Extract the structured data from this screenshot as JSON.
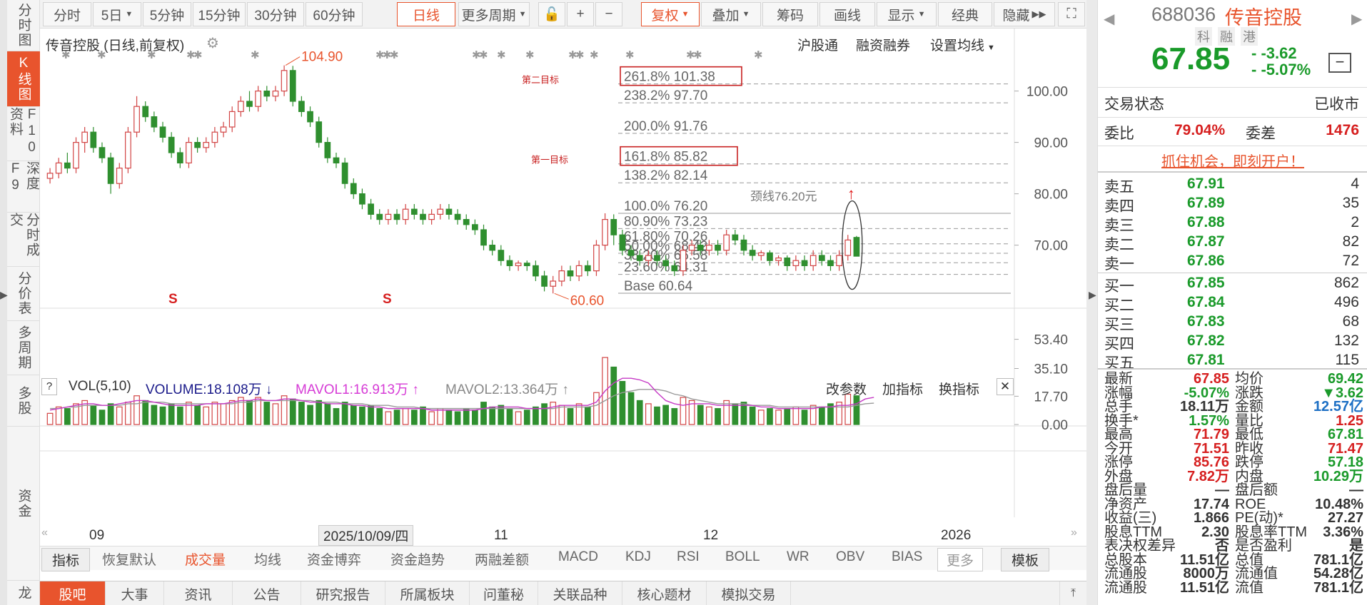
{
  "left_nav": [
    "分时图",
    "K线图",
    "F10资料",
    "深度F9",
    "分时成交",
    "分价表",
    "多周期",
    "多股",
    "资金",
    "龙"
  ],
  "toolbar": {
    "periods": [
      "分时",
      "5日",
      "5分钟",
      "15分钟",
      "30分钟",
      "60分钟",
      "日线",
      "更多周期"
    ],
    "tools": [
      "复权",
      "叠加",
      "筹码",
      "画线",
      "显示",
      "经典",
      "隐藏"
    ]
  },
  "chart_header": {
    "title": "传音控股  (日线,前复权)",
    "links": [
      "沪股通",
      "融资融券",
      "设置均线"
    ]
  },
  "annotations": {
    "high_label": "104.90",
    "low_label": "60.60",
    "target2_label": "第二目标",
    "target1_label": "第一目标",
    "neckline_label": "颈线76.20元",
    "fib_levels": [
      {
        "label": "261.8% 101.38",
        "value": 101.38,
        "boxed": true
      },
      {
        "label": "238.2% 97.70",
        "value": 97.7
      },
      {
        "label": "200.0% 91.76",
        "value": 91.76
      },
      {
        "label": "161.8% 85.82",
        "value": 85.82,
        "boxed": true
      },
      {
        "label": "138.2% 82.14",
        "value": 82.14
      },
      {
        "label": "100.0% 76.20",
        "value": 76.2
      },
      {
        "label": "80.90% 73.23",
        "value": 73.23
      },
      {
        "label": "61.80% 70.26",
        "value": 70.26
      },
      {
        "label": "50.00% 68.42",
        "value": 68.42
      },
      {
        "label": "38.20% 66.58",
        "value": 66.58
      },
      {
        "label": "23.60% 64.31",
        "value": 64.31
      },
      {
        "label": "Base 60.64",
        "value": 60.64
      }
    ]
  },
  "volume_header": {
    "q": "?",
    "vol": "VOL(5,10)",
    "volume": "VOLUME:18.108万",
    "mavol1": "MAVOL1:16.913万",
    "mavol2": "MAVOL2:13.364万",
    "links": [
      "改参数",
      "加指标",
      "换指标"
    ]
  },
  "x_axis": {
    "labels": [
      "09",
      "11",
      "12",
      "2026"
    ],
    "cursor_date": "2025/10/09/四"
  },
  "indicator_tabs": [
    "指标",
    "恢复默认",
    "成交量",
    "均线",
    "资金博弈",
    "资金趋势",
    "两融差额",
    "MACD",
    "KDJ",
    "RSI",
    "BOLL",
    "WR",
    "OBV",
    "BIAS",
    "更多",
    "模板"
  ],
  "bottom_tabs": [
    "股吧",
    "大事",
    "资讯",
    "公告",
    "研究报告",
    "所属板块",
    "问董秘",
    "关联品种",
    "核心题材",
    "模拟交易"
  ],
  "quote": {
    "code": "688036",
    "name": "传音控股",
    "tags": [
      "科",
      "融",
      "港"
    ],
    "price": "67.85",
    "change": "-3.62",
    "change_pct": "-5.07%",
    "status_label": "交易状态",
    "status_value": "已收市",
    "ratio_label": "委比",
    "ratio_value": "79.04%",
    "diff_label": "委差",
    "diff_value": "1476",
    "promo": "抓住机会，即刻开户！",
    "asks": [
      {
        "label": "卖五",
        "price": "67.91",
        "vol": "4"
      },
      {
        "label": "卖四",
        "price": "67.89",
        "vol": "35"
      },
      {
        "label": "卖三",
        "price": "67.88",
        "vol": "2"
      },
      {
        "label": "卖二",
        "price": "67.87",
        "vol": "82"
      },
      {
        "label": "卖一",
        "price": "67.86",
        "vol": "72"
      }
    ],
    "bids": [
      {
        "label": "买一",
        "price": "67.85",
        "vol": "862"
      },
      {
        "label": "买二",
        "price": "67.84",
        "vol": "496"
      },
      {
        "label": "买三",
        "price": "67.83",
        "vol": "68"
      },
      {
        "label": "买四",
        "price": "67.82",
        "vol": "132"
      },
      {
        "label": "买五",
        "price": "67.81",
        "vol": "115"
      }
    ],
    "stats": [
      [
        "最新",
        "67.85",
        "均价",
        "69.42"
      ],
      [
        "涨幅",
        "-5.07%",
        "涨跌",
        "▼3.62"
      ],
      [
        "总手",
        "18.11万",
        "金额",
        "12.57亿"
      ],
      [
        "换手*",
        "1.57%",
        "量比",
        "1.25"
      ],
      [
        "最高",
        "71.79",
        "最低",
        "67.81"
      ],
      [
        "今开",
        "71.51",
        "昨收",
        "71.47"
      ],
      [
        "涨停",
        "85.76",
        "跌停",
        "57.18"
      ],
      [
        "外盘",
        "7.82万",
        "内盘",
        "10.29万"
      ],
      [
        "盘后量",
        "—",
        "盘后额",
        "—"
      ],
      [
        "净资产",
        "17.74",
        "ROE",
        "10.48%"
      ],
      [
        "收益(三)",
        "1.866",
        "PE(动)*",
        "27.27"
      ],
      [
        "股息TTM",
        "2.30",
        "股息率TTM",
        "3.36%"
      ],
      [
        "表决权差异",
        "否",
        "是否盈利",
        "是"
      ],
      [
        "总股本",
        "11.51亿",
        "总值",
        "781.1亿"
      ],
      [
        "流通股",
        "8000万",
        "流通值",
        "54.28亿"
      ],
      [
        "流通股",
        "11.51亿",
        "流值",
        "781.1亿"
      ]
    ]
  },
  "chart_data": {
    "type": "candlestick",
    "y_ticks": [
      100.0,
      90.0,
      80.0,
      70.0
    ],
    "ylim": [
      58,
      108
    ],
    "vol_ticks": [
      "53.40",
      "35.10",
      "17.70",
      "0.00"
    ],
    "vol_max": 55,
    "candles": [
      [
        83,
        84,
        82,
        85,
        7
      ],
      [
        84,
        86,
        83,
        87,
        11
      ],
      [
        86,
        85,
        84,
        88,
        10
      ],
      [
        85,
        90,
        84,
        91,
        13
      ],
      [
        90,
        92,
        88,
        93,
        15
      ],
      [
        92,
        89,
        88,
        93,
        12
      ],
      [
        89,
        87,
        86,
        90,
        9
      ],
      [
        87,
        82,
        80,
        88,
        13
      ],
      [
        82,
        85,
        81,
        86,
        11
      ],
      [
        85,
        92,
        84,
        93,
        14
      ],
      [
        92,
        97,
        91,
        99,
        18
      ],
      [
        97,
        95,
        94,
        98,
        15
      ],
      [
        95,
        93,
        92,
        96,
        12
      ],
      [
        93,
        91,
        90,
        94,
        11
      ],
      [
        91,
        88,
        87,
        92,
        13
      ],
      [
        88,
        86,
        85,
        89,
        11
      ],
      [
        86,
        90,
        85,
        91,
        14
      ],
      [
        90,
        89,
        88,
        91,
        12
      ],
      [
        89,
        90,
        88,
        91,
        11
      ],
      [
        90,
        92,
        89,
        93,
        14
      ],
      [
        92,
        93,
        91,
        94,
        13
      ],
      [
        93,
        96,
        92,
        97,
        15
      ],
      [
        96,
        98,
        95,
        99,
        17
      ],
      [
        98,
        97,
        96,
        100,
        15
      ],
      [
        97,
        100,
        96,
        101,
        17
      ],
      [
        100,
        99,
        98,
        101,
        14
      ],
      [
        99,
        100,
        98,
        101,
        13
      ],
      [
        100,
        104,
        99,
        105,
        18
      ],
      [
        104,
        98,
        97,
        104.9,
        16
      ],
      [
        98,
        96,
        95,
        99,
        14
      ],
      [
        96,
        94,
        93,
        97,
        12
      ],
      [
        94,
        90,
        89,
        95,
        15
      ],
      [
        90,
        87,
        86,
        91,
        13
      ],
      [
        87,
        86,
        85,
        88,
        10
      ],
      [
        86,
        82,
        81,
        87,
        14
      ],
      [
        82,
        80,
        79,
        83,
        12
      ],
      [
        80,
        78,
        77,
        81,
        11
      ],
      [
        78,
        76,
        75,
        79,
        12
      ],
      [
        76,
        75,
        74,
        77,
        10
      ],
      [
        75,
        76,
        74,
        77,
        8
      ],
      [
        76,
        75,
        74,
        77,
        9
      ],
      [
        75,
        77,
        74,
        78,
        10
      ],
      [
        77,
        76,
        75,
        78,
        9
      ],
      [
        76,
        75,
        74,
        77,
        11
      ],
      [
        75,
        76,
        74,
        77,
        8
      ],
      [
        76,
        77,
        75,
        78,
        10
      ],
      [
        77,
        76,
        75,
        78,
        9
      ],
      [
        76,
        75,
        74,
        77,
        8
      ],
      [
        75,
        74,
        73,
        76,
        10
      ],
      [
        74,
        73,
        72,
        75,
        9
      ],
      [
        73,
        70,
        69,
        74,
        14
      ],
      [
        70,
        69,
        68,
        71,
        11
      ],
      [
        69,
        67,
        66,
        70,
        12
      ],
      [
        67,
        66,
        65,
        68,
        10
      ],
      [
        66,
        66.5,
        65,
        67,
        8
      ],
      [
        66.5,
        66,
        65,
        67,
        9
      ],
      [
        66,
        64,
        63,
        67,
        11
      ],
      [
        64,
        62,
        61,
        65,
        13
      ],
      [
        62,
        63,
        60.6,
        64,
        14
      ],
      [
        63,
        65,
        62,
        66,
        12
      ],
      [
        65,
        64,
        63,
        66,
        10
      ],
      [
        64,
        66,
        63,
        67,
        13
      ],
      [
        66,
        65,
        64,
        67,
        11
      ],
      [
        65,
        70,
        64,
        71,
        20
      ],
      [
        70,
        75,
        69,
        76.2,
        42
      ],
      [
        75,
        72,
        70,
        76,
        36
      ],
      [
        72,
        69,
        68,
        73,
        27
      ],
      [
        69,
        68,
        67,
        70,
        20
      ],
      [
        68,
        67,
        66,
        69,
        15
      ],
      [
        67,
        68,
        66,
        69,
        13
      ],
      [
        68,
        67,
        66,
        69,
        11
      ],
      [
        67,
        66,
        65,
        68,
        12
      ],
      [
        66,
        65,
        64,
        67,
        10
      ],
      [
        65,
        69,
        64,
        70,
        17
      ],
      [
        69,
        70,
        68,
        71,
        15
      ],
      [
        70,
        69,
        68,
        71,
        12
      ],
      [
        69,
        70,
        68,
        71,
        11
      ],
      [
        70,
        69,
        68,
        71,
        10
      ],
      [
        69,
        72,
        68,
        73,
        15
      ],
      [
        72,
        71,
        70,
        73,
        13
      ],
      [
        71,
        69,
        68,
        72,
        14
      ],
      [
        69,
        68,
        67,
        70,
        11
      ],
      [
        68,
        68.5,
        67,
        69,
        9
      ],
      [
        68.5,
        67,
        66,
        69,
        10
      ],
      [
        67,
        67.5,
        66,
        68,
        9
      ],
      [
        67.5,
        66,
        65,
        68,
        10
      ],
      [
        66,
        67,
        65,
        68,
        11
      ],
      [
        67,
        66,
        65,
        68,
        9
      ],
      [
        66,
        68,
        65,
        69,
        12
      ],
      [
        68,
        67,
        66,
        69,
        11
      ],
      [
        67,
        66,
        65,
        68,
        13
      ],
      [
        66,
        68,
        65,
        69,
        14
      ],
      [
        68,
        71,
        67,
        72,
        19
      ],
      [
        71.5,
        67.85,
        67.81,
        71.79,
        18
      ]
    ],
    "mavol1": [
      9,
      10,
      11,
      12,
      13,
      13,
      12,
      12,
      13,
      14,
      15,
      15,
      14,
      13,
      12,
      12,
      12,
      12,
      13,
      13,
      13,
      14,
      15,
      15,
      16,
      15,
      15,
      16,
      16,
      15,
      14,
      14,
      13,
      13,
      13,
      12,
      12,
      11,
      11,
      10,
      10,
      10,
      10,
      10,
      9,
      9,
      9,
      9,
      9,
      9,
      10,
      11,
      11,
      11,
      11,
      10,
      10,
      10,
      11,
      12,
      12,
      12,
      12,
      14,
      21,
      26,
      29,
      29,
      28,
      26,
      20,
      15,
      13,
      12,
      13,
      13,
      13,
      12,
      12,
      12,
      12,
      12,
      11,
      11,
      10,
      10,
      10,
      10,
      10,
      11,
      11,
      12,
      12,
      13,
      16,
      17
    ],
    "mavol2": [
      10,
      10,
      11,
      11,
      12,
      12,
      12,
      12,
      12,
      13,
      13,
      14,
      14,
      14,
      13,
      13,
      13,
      13,
      13,
      13,
      13,
      13,
      14,
      14,
      15,
      15,
      15,
      15,
      15,
      15,
      15,
      14,
      14,
      14,
      13,
      13,
      13,
      12,
      12,
      12,
      11,
      11,
      11,
      10,
      10,
      10,
      10,
      10,
      10,
      10,
      10,
      10,
      10,
      10,
      10,
      10,
      10,
      10,
      10,
      11,
      11,
      11,
      11,
      12,
      15,
      18,
      20,
      21,
      22,
      22,
      22,
      21,
      19,
      18,
      16,
      15,
      14,
      13,
      13,
      13,
      13,
      12,
      12,
      12,
      11,
      11,
      11,
      11,
      11,
      11,
      11,
      11,
      11,
      12,
      13,
      13.4
    ]
  }
}
